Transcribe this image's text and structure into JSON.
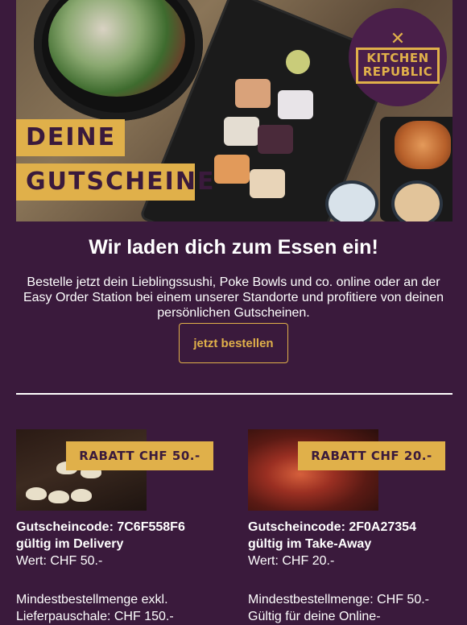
{
  "hero": {
    "title_line1": "DEINE",
    "title_line2": "GUTSCHEINE",
    "logo_line1": "KITCHEN",
    "logo_line2": "REPUBLIC",
    "logo_icon": "fork-knife-icon"
  },
  "main": {
    "headline": "Wir laden dich zum Essen ein!",
    "intro": "Bestelle jetzt dein Lieblingssushi, Poke Bowls und co. online oder an der Easy Order Station bei einem unserer Standorte und profitiere von deinen persönlichen Gutscheinen.",
    "cta_label": "jetzt bestellen"
  },
  "vouchers": [
    {
      "badge": "RABATT CHF 50.-",
      "code_line": "Gutscheincode: 7C6F558F6",
      "validity": "gültig im Delivery",
      "value": "Wert: CHF 50.-",
      "note_line1": "Mindestbestellmenge exkl.",
      "note_line2": "Lieferpauschale: CHF 150.-"
    },
    {
      "badge": "RABATT CHF 20.-",
      "code_line": "Gutscheincode: 2F0A27354",
      "validity": "gültig im Take-Away",
      "value": "Wert: CHF 20.-",
      "note_line1": "Mindestbestellmenge: CHF 50.-",
      "note_line2": "Gültig für deine Online-"
    }
  ],
  "colors": {
    "background": "#3a1a3c",
    "accent": "#e0b04a",
    "text": "#ffffff"
  }
}
